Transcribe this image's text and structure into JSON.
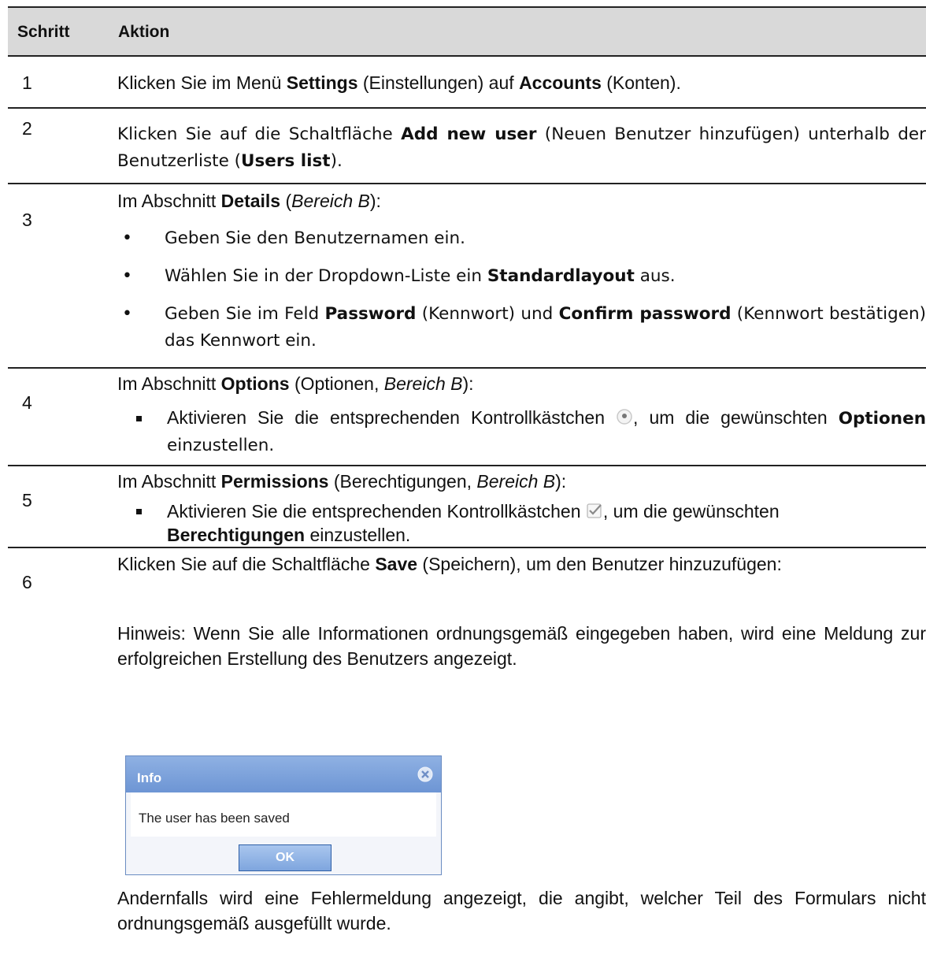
{
  "header": {
    "col_step": "Schritt",
    "col_action": "Aktion"
  },
  "rows": [
    {
      "num": "1",
      "t1": "Klicken Sie im Menü ",
      "b1": "Settings",
      "t2": " (Einstellungen) auf ",
      "b2": "Accounts",
      "t3": " (Konten)."
    },
    {
      "num": "2",
      "t1": "Klicken Sie auf die Schaltfläche ",
      "b1": "Add new user",
      "t2": " (Neuen Benutzer hinzufügen) unterhalb der Benutzerliste (",
      "b2": "Users list",
      "t3": ")."
    },
    {
      "num": "3",
      "t1": "Im Abschnitt ",
      "b1": "Details",
      "t2": " (",
      "i1": "Bereich B",
      "t3": "):",
      "bullets": [
        {
          "t1": "Geben Sie den Benutzernamen ein."
        },
        {
          "t1": "Wählen Sie in der Dropdown-Liste ein ",
          "b1": "Standardlayout",
          "t2": " aus."
        },
        {
          "t1": "Geben Sie im Feld ",
          "b1": "Password",
          "t2": " (Kennwort) und ",
          "b2": "Confirm password",
          "t3": " (Kennwort bestätigen) das Kennwort ein."
        }
      ]
    },
    {
      "num": "4",
      "t1": "Im Abschnitt ",
      "b1": "Options",
      "t2": " (Optionen, ",
      "i1": "Bereich B",
      "t3": "):",
      "item": {
        "t1": "Aktivieren Sie die entsprechenden Kontrollkästchen ",
        "icon": "radio-button-icon",
        "t2": ", um die gewünschten ",
        "b1": "Optionen",
        "t3": " einzustellen."
      }
    },
    {
      "num": "5",
      "t1": "Im Abschnitt ",
      "b1": "Permissions",
      "t2": " (Berechtigungen, ",
      "i1": "Bereich B",
      "t3": "):",
      "item": {
        "t1": "Aktivieren Sie die entsprechenden Kontrollkästchen ",
        "icon": "checkbox-icon",
        "t2": ", um die gewünschten ",
        "b1": "Berechtigungen",
        "t3": " einzustellen."
      }
    },
    {
      "num": "6",
      "t1": "Klicken Sie auf die Schaltfläche ",
      "b1": "Save",
      "t2": " (Speichern), um den Benutzer hinzuzufügen:",
      "note": "Hinweis: Wenn Sie alle Informationen ordnungsgemäß eingegeben haben, wird eine Meldung zur erfolgreichen Erstellung des Benutzers angezeigt.",
      "dialog": {
        "title": "Info",
        "message": "The user has been saved",
        "ok_label": "OK"
      },
      "footer": "Andernfalls wird eine Fehlermeldung angezeigt, die angibt, welcher Teil des Formulars nicht ordnungsgemäß ausgefüllt wurde."
    }
  ],
  "colors": {
    "header_bg": "#d9d9d9",
    "dialog_title": "#7aa0da",
    "dialog_button": "#8fb3e6"
  }
}
